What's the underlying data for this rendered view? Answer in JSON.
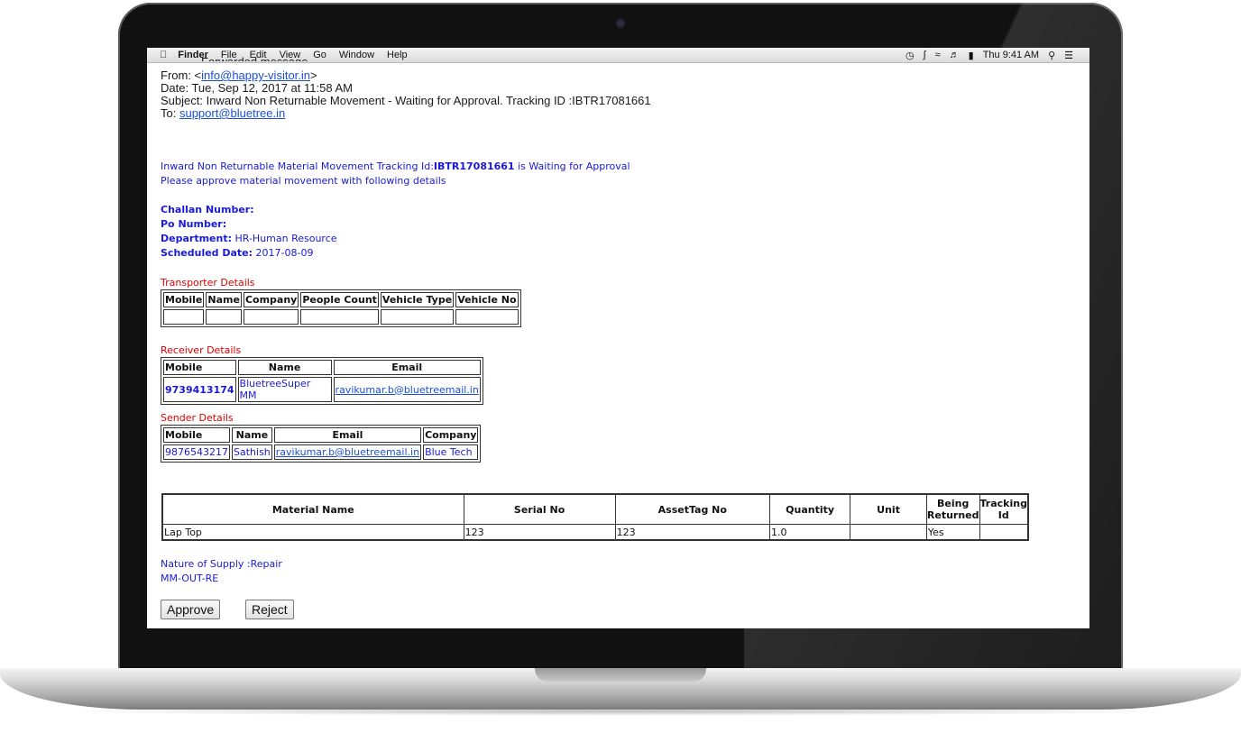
{
  "menubar": {
    "apple": "",
    "items": [
      "Finder",
      "File",
      "Edit",
      "View",
      "Go",
      "Window",
      "Help"
    ],
    "clock": "Thu 9:41 AM"
  },
  "email": {
    "forwarded": "Forwarded message",
    "from_label": "From: <",
    "from_email": "info@happy-visitor.in",
    "from_suffix": ">",
    "date": "Date: Tue, Sep 12, 2017 at 11:58 AM",
    "subject": "Subject: Inward Non Returnable Movement - Waiting for Approval. Tracking ID :IBTR17081661",
    "to_label": "To: ",
    "to_email": "support@bluetree.in"
  },
  "body": {
    "line1_prefix": "Inward Non Returnable Material Movement Tracking Id:",
    "tracking_id": "IBTR17081661",
    "line1_suffix": " is Waiting for Approval",
    "line2": "Please approve material movement with following details",
    "challan_label": "Challan Number:",
    "po_label": "Po Number:",
    "department_label": "Department:",
    "department_value": " HR-Human Resource",
    "scheduled_label": "Scheduled Date:",
    "scheduled_value": " 2017-08-09",
    "nature": "Nature of Supply :Repair",
    "code": "MM-OUT-RE"
  },
  "transporter": {
    "title": "Transporter Details",
    "headers": [
      "Mobile",
      "Name",
      "Company",
      "People Count",
      "Vehicle Type",
      "Vehicle No"
    ]
  },
  "receiver": {
    "title": "Receiver Details",
    "headers": [
      "Mobile",
      "Name",
      "Email"
    ],
    "row": [
      "9739413174",
      "BluetreeSuper MM",
      "ravikumar.b@bluetreemail.in"
    ]
  },
  "sender": {
    "title": "Sender Details",
    "headers": [
      "Mobile",
      "Name",
      "Email",
      "Company"
    ],
    "row": [
      "9876543217",
      "Sathish",
      "ravikumar.b@bluetreemail.in",
      "Blue Tech"
    ]
  },
  "materials": {
    "headers": [
      "Material Name",
      "Serial No",
      "AssetTag No",
      "Quantity",
      "Unit",
      "Being Returned",
      "Tracking Id"
    ],
    "row": [
      "Lap Top",
      "123",
      "123",
      "1.0",
      "",
      "Yes",
      ""
    ]
  },
  "actions": {
    "approve": "Approve",
    "reject": "Reject"
  }
}
